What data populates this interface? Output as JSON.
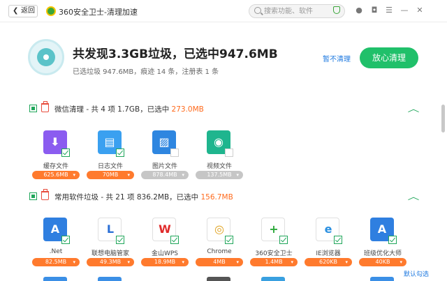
{
  "titlebar": {
    "back_label": "返回",
    "app_title": "360安全卫士-清理加速",
    "search_placeholder": "搜索功能、软件"
  },
  "header": {
    "title": "共发现3.3GB垃圾，已选中947.6MB",
    "subtitle": "已选垃圾 947.6MB，痕迹 14 条，注册表 1 条",
    "pause_label": "暂不清理",
    "clean_label": "放心清理"
  },
  "sections": [
    {
      "title_prefix": "微信清理 - 共 4 项 1.7GB，已选中 ",
      "title_highlight": "273.0MB",
      "items": [
        {
          "name": "缓存文件",
          "size": "625.6MB",
          "color": "#8b5cf0",
          "glyph": "⬇",
          "checked": true,
          "selected": true
        },
        {
          "name": "日志文件",
          "size": "70MB",
          "color": "#3aa0f0",
          "glyph": "▤",
          "checked": true,
          "selected": true
        },
        {
          "name": "图片文件",
          "size": "878.4MB",
          "color": "#2e86e0",
          "glyph": "▨",
          "checked": false,
          "selected": false
        },
        {
          "name": "视频文件",
          "size": "137.5MB",
          "color": "#1fb58e",
          "glyph": "◉",
          "checked": false,
          "selected": false
        }
      ]
    },
    {
      "title_prefix": "常用软件垃圾 - 共 21 项 836.2MB，已选中 ",
      "title_highlight": "156.7MB",
      "items": [
        {
          "name": ".Net",
          "size": "82.5MB",
          "color": "#2f7fe0",
          "glyph": "A",
          "checked": true,
          "selected": true
        },
        {
          "name": "联想电脑管家",
          "size": "49.3MB",
          "color": "#ffffff",
          "glyph": "L",
          "checked": true,
          "selected": true
        },
        {
          "name": "金山WPS",
          "size": "18.9MB",
          "color": "#ffffff",
          "glyph": "W",
          "checked": true,
          "selected": true
        },
        {
          "name": "Chrome",
          "size": "4MB",
          "color": "#ffffff",
          "glyph": "◎",
          "checked": true,
          "selected": true
        },
        {
          "name": "360安全卫士",
          "size": "1.4MB",
          "color": "#ffffff",
          "glyph": "+",
          "checked": true,
          "selected": true
        },
        {
          "name": "IE浏览器",
          "size": "620KB",
          "color": "#ffffff",
          "glyph": "e",
          "checked": true,
          "selected": true
        },
        {
          "name": "班级优化大师",
          "size": "40KB",
          "color": "#2f7fe0",
          "glyph": "A",
          "checked": true,
          "selected": true
        }
      ]
    }
  ],
  "footer": {
    "default_check_label": "默认勾选"
  }
}
